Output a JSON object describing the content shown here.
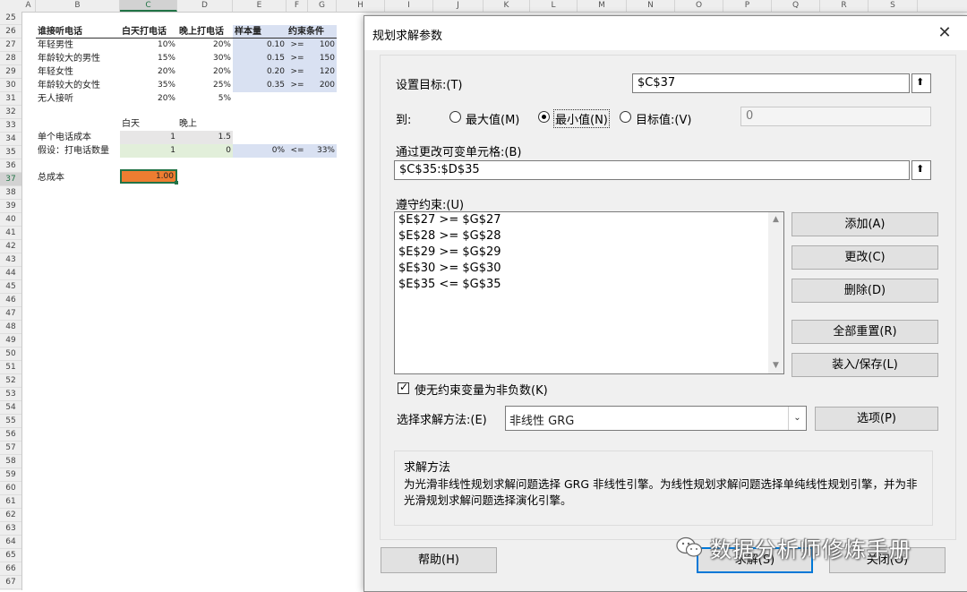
{
  "sheet": {
    "columns": [
      "A",
      "B",
      "C",
      "D",
      "E",
      "F",
      "G",
      "H",
      "I",
      "J",
      "K",
      "L",
      "M",
      "N",
      "O",
      "P",
      "Q",
      "R",
      "S"
    ],
    "rows": [
      "25",
      "26",
      "27",
      "28",
      "29",
      "30",
      "31",
      "32",
      "33",
      "34",
      "35",
      "36",
      "37",
      "38",
      "39",
      "40",
      "41",
      "42",
      "43",
      "44",
      "45",
      "46",
      "47",
      "48",
      "49",
      "50",
      "51",
      "52",
      "53",
      "54",
      "55",
      "56",
      "57",
      "58",
      "59",
      "60",
      "61",
      "62",
      "63",
      "64",
      "65",
      "66",
      "67"
    ],
    "r26": {
      "b": "谁接听电话",
      "c": "白天打电话",
      "d": "晚上打电话",
      "e": "样本量",
      "g": "约束条件"
    },
    "r27": {
      "b": "年轻男性",
      "c": "10%",
      "d": "20%",
      "e": "0.10",
      "f": ">=",
      "g": "100"
    },
    "r28": {
      "b": "年龄较大的男性",
      "c": "15%",
      "d": "30%",
      "e": "0.15",
      "f": ">=",
      "g": "150"
    },
    "r29": {
      "b": "年轻女性",
      "c": "20%",
      "d": "20%",
      "e": "0.20",
      "f": ">=",
      "g": "120"
    },
    "r30": {
      "b": "年龄较大的女性",
      "c": "35%",
      "d": "25%",
      "e": "0.35",
      "f": ">=",
      "g": "200"
    },
    "r31": {
      "b": "无人接听",
      "c": "20%",
      "d": "5%"
    },
    "r33": {
      "c": "白天",
      "d": "晚上"
    },
    "r34": {
      "b": "单个电话成本",
      "c": "1",
      "d": "1.5"
    },
    "r35": {
      "b": "假设：打电话数量",
      "c": "1",
      "d": "0",
      "e": "0%",
      "f": "<=",
      "g": "33%"
    },
    "r37": {
      "b": "总成本",
      "c": "1.00"
    }
  },
  "dialog": {
    "title": "规划求解参数",
    "close_icon": "close-icon",
    "objective_label": "设置目标:(T)",
    "objective_value": "$C$37",
    "to_label": "到:",
    "radio_max": "最大值(M)",
    "radio_min": "最小值(N)",
    "radio_value": "目标值:(V)",
    "selected_radio": "min",
    "target_value": "0",
    "variables_label": "通过更改可变单元格:(B)",
    "variables_value": "$C$35:$D$35",
    "constraints_label": "遵守约束:(U)",
    "constraints": [
      "$E$27 >= $G$27",
      "$E$28 >= $G$28",
      "$E$29 >= $G$29",
      "$E$30 >= $G$30",
      "$E$35 <= $G$35"
    ],
    "btn_add": "添加(A)",
    "btn_change": "更改(C)",
    "btn_delete": "删除(D)",
    "btn_reset": "全部重置(R)",
    "btn_load": "装入/保存(L)",
    "nonneg_label": "使无约束变量为非负数(K)",
    "nonneg_checked": true,
    "method_label": "选择求解方法:(E)",
    "method_value": "非线性 GRG",
    "btn_options": "选项(P)",
    "desc_title": "求解方法",
    "desc_text": "为光滑非线性规划求解问题选择 GRG 非线性引擎。为线性规划求解问题选择单纯线性规划引擎，并为非光滑规划求解问题选择演化引擎。",
    "btn_help": "帮助(H)",
    "btn_solve": "求解(S)",
    "btn_close": "关闭(O)"
  },
  "watermark": {
    "text": "数据分析师修炼手册"
  }
}
